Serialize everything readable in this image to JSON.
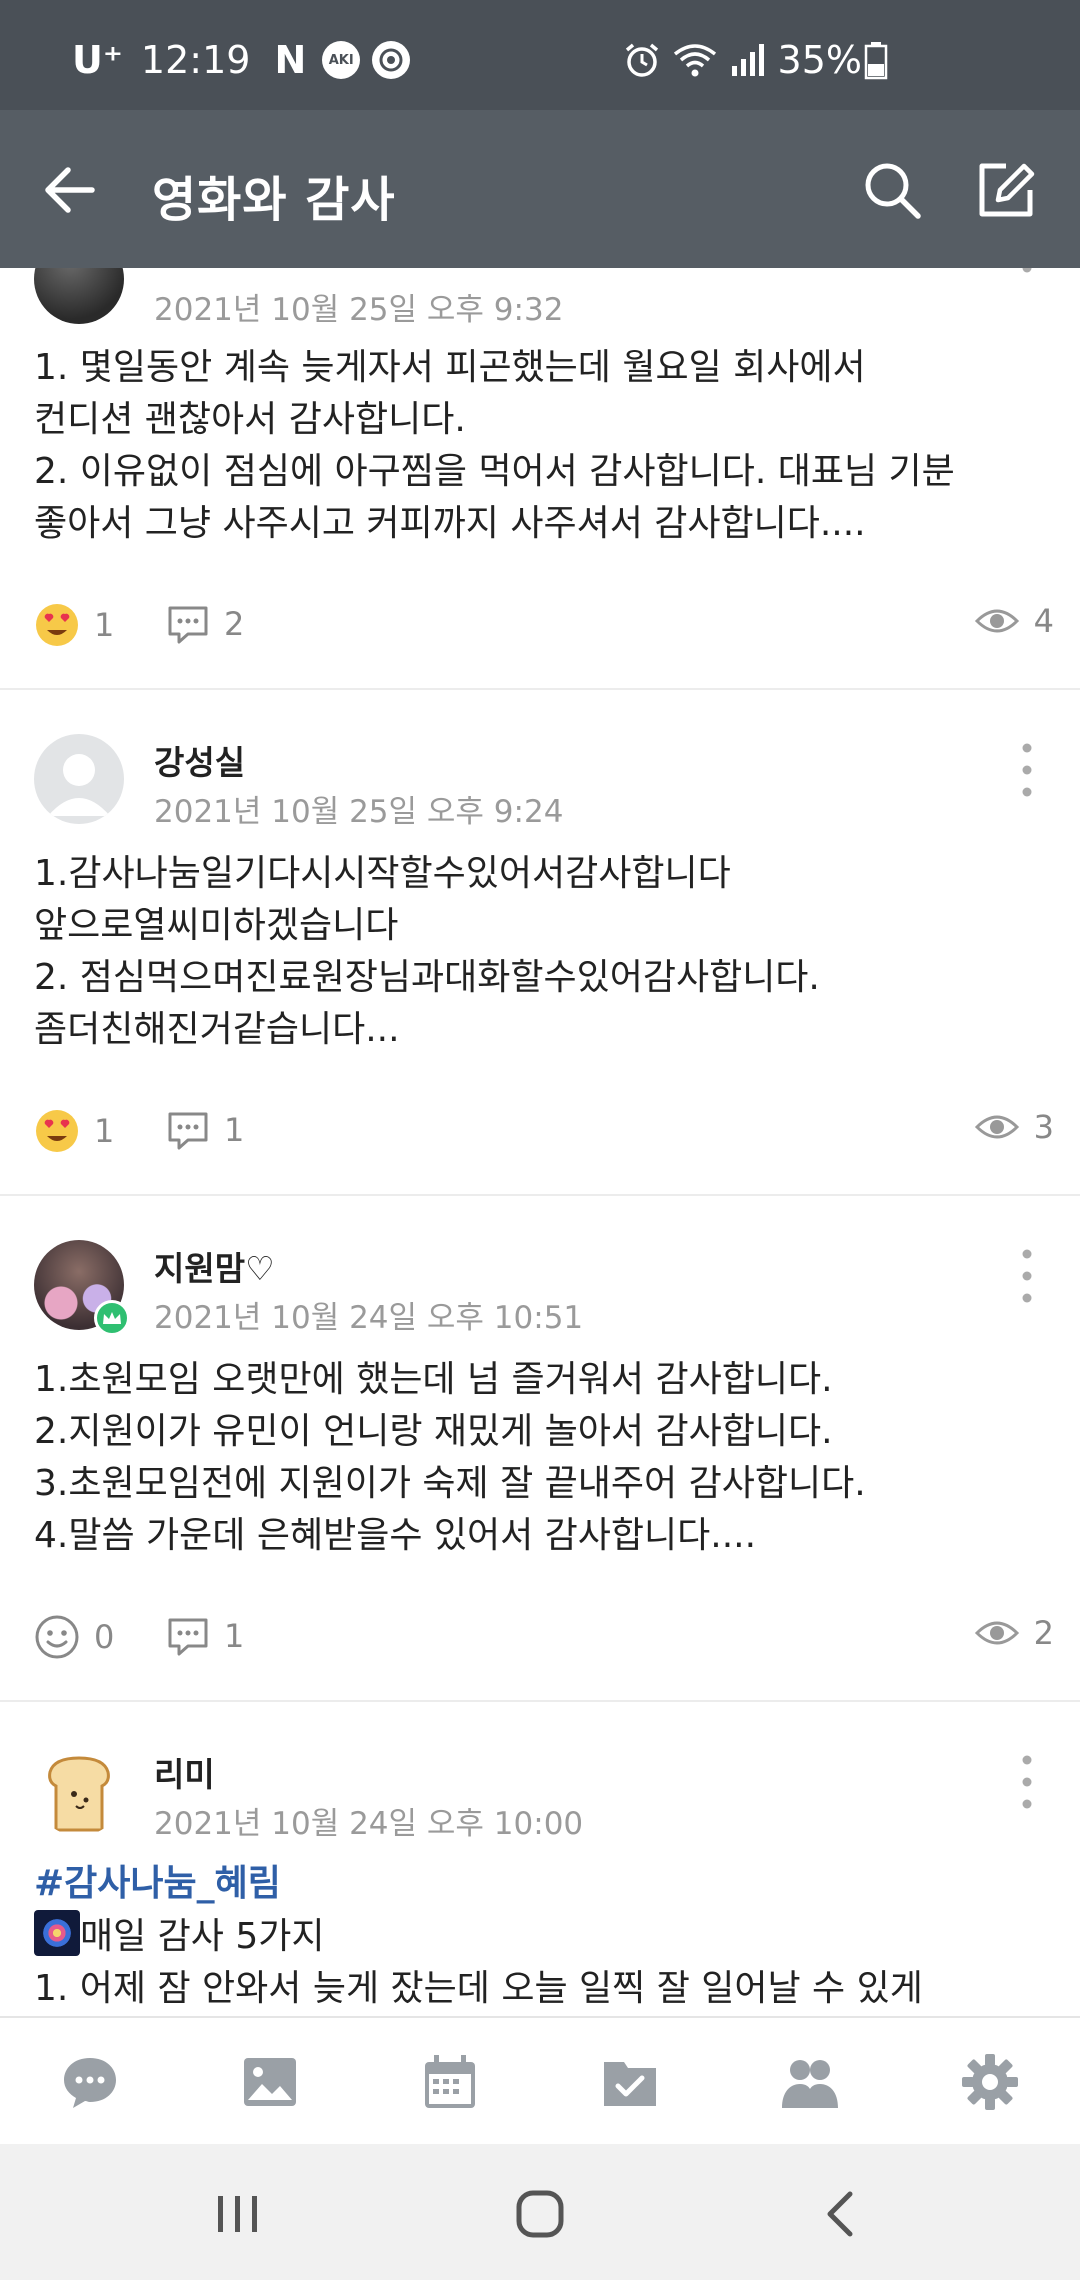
{
  "status_bar": {
    "carrier": "U⁺",
    "time": "12:19",
    "badge1": "AKI",
    "battery": "35%",
    "icons": [
      "netflix-n-icon",
      "aki-badge-icon",
      "app-badge-icon",
      "alarm-icon",
      "wifi-icon",
      "signal-icon",
      "battery-icon"
    ]
  },
  "app_bar": {
    "title": "영화와 감사",
    "icons": [
      "back-arrow-icon",
      "search-icon",
      "compose-icon"
    ]
  },
  "posts": [
    {
      "author": "",
      "date": "2021년 10월 25일 오후 9:32",
      "lines": [
        "1. 몇일동안 계속 늦게자서 피곤했는데 월요일 회사에서",
        "컨디션 괜찮아서 감사합니다.",
        "2. 이유없이 점심에 아구찜을 먹어서 감사합니다. 대표님 기분",
        "좋아서 그냥 사주시고 커피까지 사주셔서 감사합니다...."
      ],
      "reactions": "1",
      "reaction_icon": "heart-eyes-emoji-icon",
      "comments": "2",
      "views": "4"
    },
    {
      "author": "강성실",
      "date": "2021년 10월 25일 오후 9:24",
      "lines": [
        "1.감사나눔일기다시시작할수있어서감사합니다",
        "앞으로열씨미하겠습니다",
        "2. 점심먹으며진료원장님과대화할수있어감사합니다.",
        "좀더친해진거같습니다..."
      ],
      "reactions": "1",
      "reaction_icon": "heart-eyes-emoji-icon",
      "comments": "1",
      "views": "3"
    },
    {
      "author": "지원맘♡",
      "date": "2021년 10월 24일 오후 10:51",
      "lines": [
        "1.초원모임 오랫만에 했는데 넘 즐거워서 감사합니다.",
        "2.지원이가 유민이 언니랑 재밌게 놀아서 감사합니다.",
        "3.초원모임전에 지원이가 숙제 잘 끝내주어 감사합니다.",
        "4.말씀 가운데 은혜받을수 있어서 감사합니다...."
      ],
      "reactions": "0",
      "reaction_icon": "smiley-outline-icon",
      "comments": "1",
      "views": "2"
    },
    {
      "author": "리미",
      "date": "2021년 10월 24일 오후 10:00",
      "tag": "#감사나눔_혜림",
      "lines": [
        "매일 감사 5가지",
        "1. 어제 잠 안와서 늦게 잤는데 오늘 일찍 잘 일어날 수 있게"
      ]
    }
  ],
  "bottom_nav": [
    "chat-icon",
    "photo-icon",
    "calendar-icon",
    "todo-folder-icon",
    "members-icon",
    "settings-icon"
  ],
  "system_nav": [
    "recent-apps-icon",
    "home-icon",
    "back-icon"
  ],
  "colors": {
    "status_bar": "#4a5057",
    "app_bar": "#565d64",
    "tag": "#2f5fa7",
    "nav_icon": "#9aa0a6",
    "date_text": "#9a9a9a"
  }
}
